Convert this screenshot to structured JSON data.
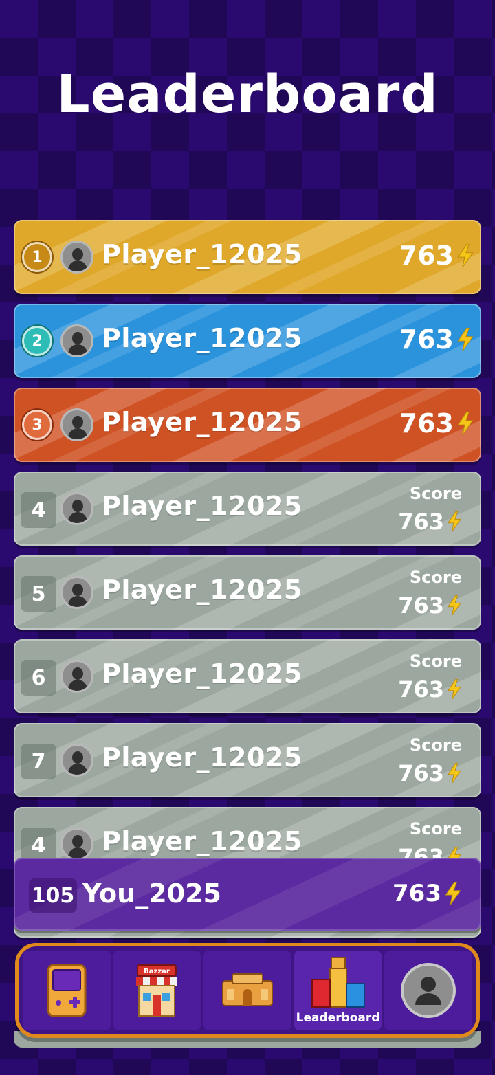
{
  "page": {
    "title": "Leaderboard"
  },
  "rows": [
    {
      "rank": "1",
      "name": "Player_12025",
      "score": "763",
      "style": "gold"
    },
    {
      "rank": "2",
      "name": "Player_12025",
      "score": "763",
      "style": "blue"
    },
    {
      "rank": "3",
      "name": "Player_12025",
      "score": "763",
      "style": "bronze"
    },
    {
      "rank": "4",
      "name": "Player_12025",
      "score_label": "Score",
      "score": "763",
      "style": "gray"
    },
    {
      "rank": "5",
      "name": "Player_12025",
      "score_label": "Score",
      "score": "763",
      "style": "gray"
    },
    {
      "rank": "6",
      "name": "Player_12025",
      "score_label": "Score",
      "score": "763",
      "style": "gray"
    },
    {
      "rank": "7",
      "name": "Player_12025",
      "score_label": "Score",
      "score": "763",
      "style": "gray"
    },
    {
      "rank": "4",
      "name": "Player_12025",
      "score_label": "Score",
      "score": "763",
      "style": "gray"
    }
  ],
  "current_user": {
    "rank": "105",
    "name": "You_2025",
    "score": "763"
  },
  "navbar": {
    "items": [
      {
        "icon": "game-console-icon"
      },
      {
        "icon": "bazaar-shop-icon",
        "sign": "Bazzar"
      },
      {
        "icon": "temple-icon"
      },
      {
        "icon": "podium-icon",
        "label": "Leaderboard",
        "active": true
      },
      {
        "icon": "profile-avatar-icon"
      }
    ]
  },
  "colors": {
    "background": "#2a0a6e",
    "gold": "#e0a82a",
    "blue": "#2a93dc",
    "bronze": "#cf5224",
    "gray": "#9ca89f",
    "user_row": "#5b2aa0",
    "nav_border": "#e08a1e",
    "bolt": "#f5c518"
  }
}
